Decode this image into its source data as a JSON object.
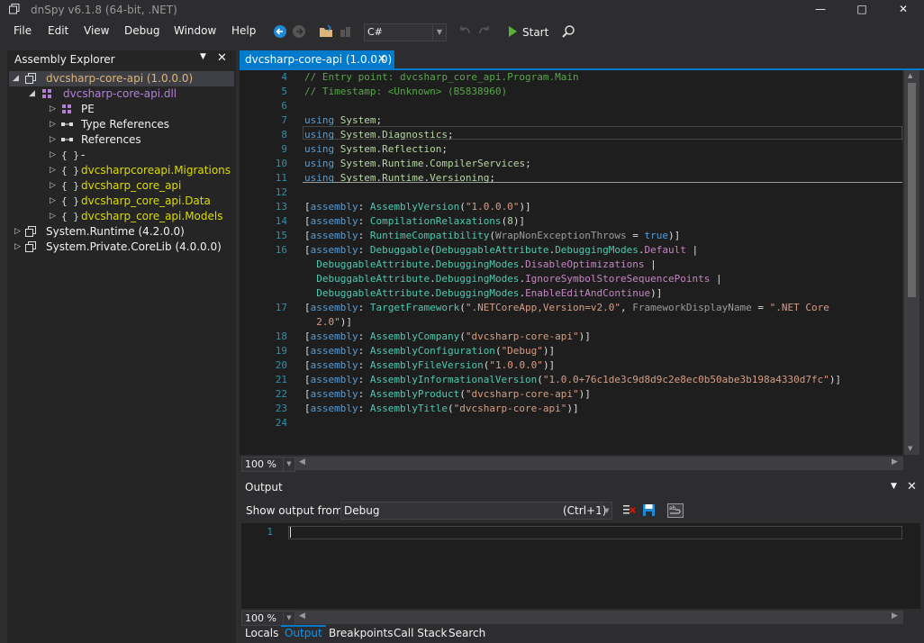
{
  "window": {
    "title": "dnSpy v6.1.8 (64-bit, .NET)",
    "minimize": "—",
    "maximize": "□",
    "close": "✕"
  },
  "menu": [
    "File",
    "Edit",
    "View",
    "Debug",
    "Window",
    "Help"
  ],
  "toolbar": {
    "language": "C#",
    "start_label": "Start"
  },
  "explorer": {
    "title": "Assembly Explorer",
    "items": [
      "dvcsharp-core-api (1.0.0.0)",
      "dvcsharp-core-api.dll",
      "PE",
      "Type References",
      "References",
      "-",
      "dvcsharpcoreapi.Migrations",
      "dvcsharp_core_api",
      "dvcsharp_core_api.Data",
      "dvcsharp_core_api.Models",
      "System.Runtime (4.2.0.0)",
      "System.Private.CoreLib (4.0.0.0)"
    ]
  },
  "editor": {
    "tab_label": "dvcsharp-core-api (1.0.0.0)",
    "line_numbers": [
      "4",
      "5",
      "6",
      "7",
      "8",
      "9",
      "10",
      "11",
      "12",
      "13",
      "14",
      "15",
      "16",
      "17",
      "18",
      "19",
      "20",
      "21",
      "22",
      "23",
      "24"
    ],
    "zoom": "100 %"
  },
  "output": {
    "title": "Output",
    "show_from_label": "Show output from:",
    "source": "Debug",
    "shortcut": "(Ctrl+1)",
    "line_number": "1",
    "zoom": "100 %"
  },
  "bottom_tabs": [
    "Locals",
    "Output",
    "Breakpoints",
    "Call Stack",
    "Search"
  ],
  "colors": {
    "accent": "#007acc",
    "background": "#2d2d30",
    "editor_bg": "#1e1e1e"
  }
}
